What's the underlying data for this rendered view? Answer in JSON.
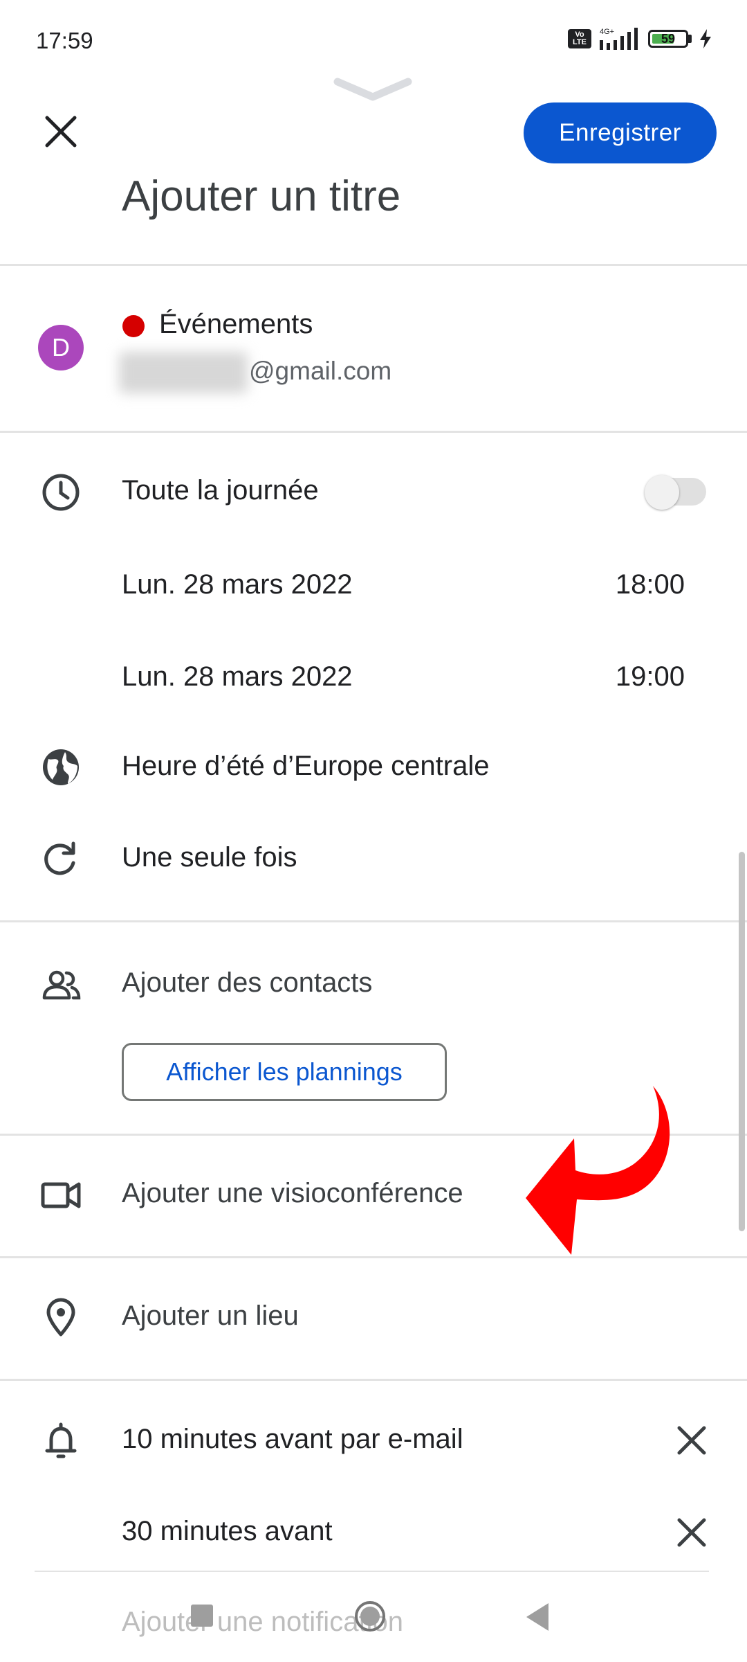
{
  "status_bar": {
    "time": "17:59",
    "volte": "Vo LTE",
    "network": "4G+",
    "battery": "59"
  },
  "header": {
    "save_label": "Enregistrer",
    "title_placeholder": "Ajouter un titre"
  },
  "calendar": {
    "avatar_letter": "D",
    "name": "Événements",
    "email_suffix": "@gmail.com",
    "color": "#d50000"
  },
  "time": {
    "all_day_label": "Toute la journée",
    "all_day_on": false,
    "start_date": "Lun. 28 mars 2022",
    "start_time": "18:00",
    "end_date": "Lun. 28 mars 2022",
    "end_time": "19:00",
    "timezone": "Heure d’été d’Europe centrale",
    "repeat": "Une seule fois"
  },
  "guests": {
    "add_label": "Ajouter des contacts",
    "schedules_button": "Afficher les plannings"
  },
  "conference": {
    "label": "Ajouter une visioconférence"
  },
  "location": {
    "label": "Ajouter un lieu"
  },
  "notifications": {
    "items": [
      "10 minutes avant par e-mail",
      "30 minutes avant"
    ],
    "add_label": "Ajouter une notification"
  },
  "colors": {
    "accent": "#0b57d0",
    "arrow": "#ff0000",
    "avatar": "#ab47bc"
  }
}
